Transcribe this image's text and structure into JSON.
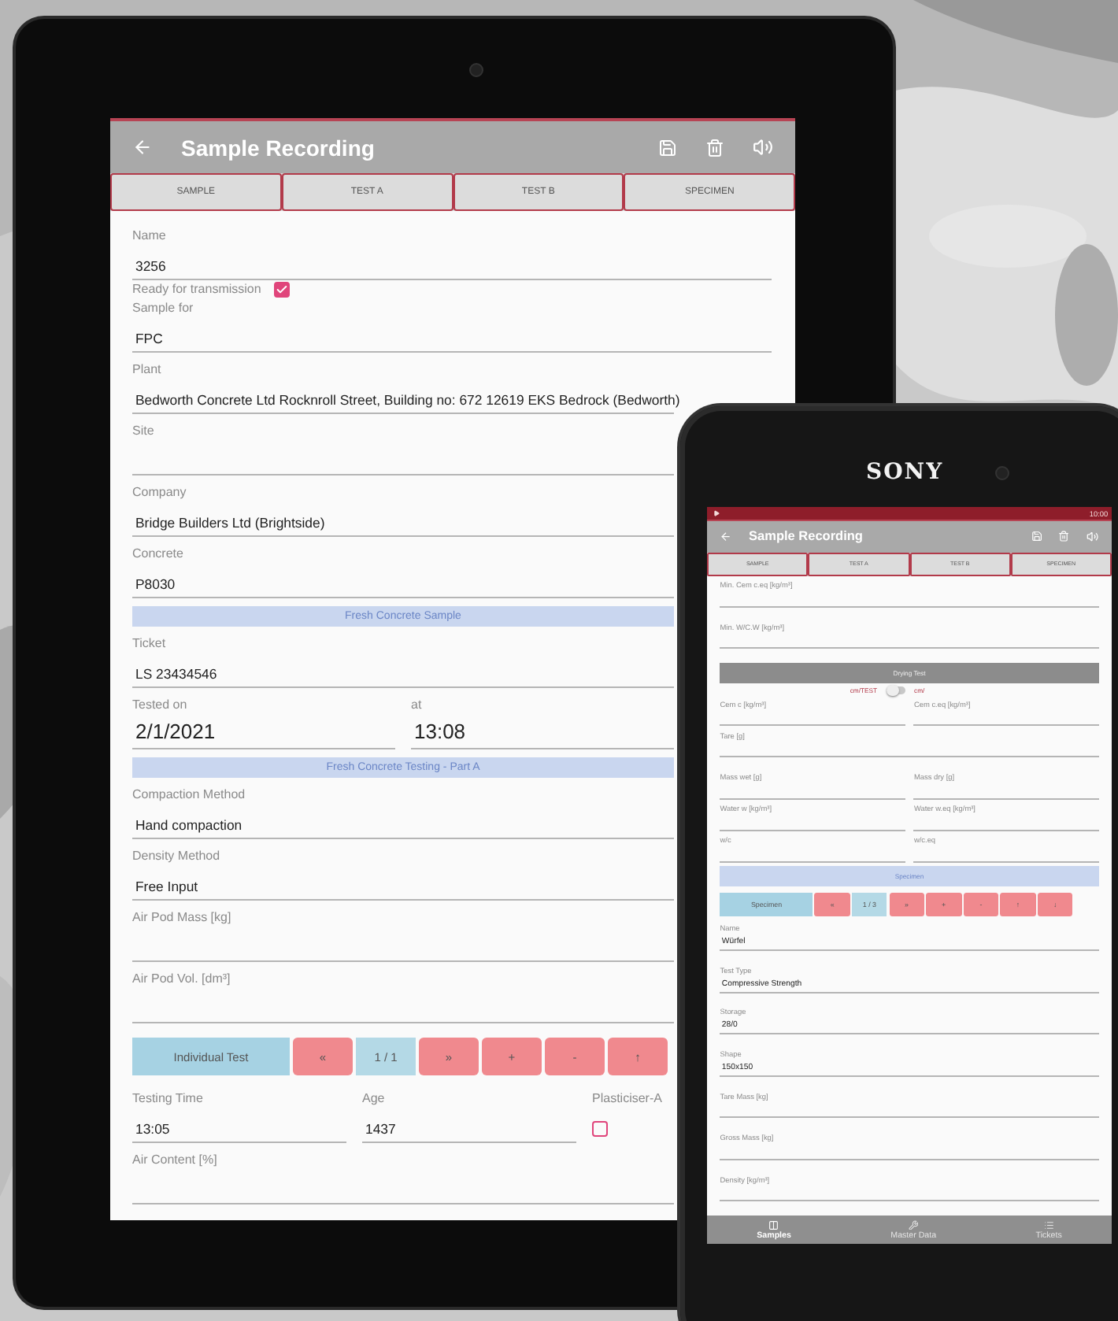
{
  "tablet": {
    "title": "Sample Recording",
    "tabs": [
      "SAMPLE",
      "TEST A",
      "TEST B",
      "SPECIMEN"
    ],
    "items": [
      {
        "kind": "field",
        "label": "Name",
        "value": "3256"
      },
      {
        "kind": "checkbox",
        "label": "Ready for transmission",
        "checked": true
      },
      {
        "kind": "field",
        "label": "Sample for",
        "value": "FPC"
      },
      {
        "kind": "field",
        "label": "Plant",
        "value": "Bedworth Concrete Ltd Rocknroll Street, Building no: 672 12619 EKS Bedrock (Bedworth)"
      },
      {
        "kind": "field",
        "label": "Site"
      },
      {
        "kind": "field",
        "label": "Company",
        "value": "Bridge Builders Ltd (Brightside)"
      },
      {
        "kind": "field",
        "label": "Concrete",
        "value": "P8030"
      },
      {
        "kind": "section",
        "label": "Fresh Concrete Sample"
      },
      {
        "kind": "field",
        "label": "Ticket",
        "value": "LS 23434546"
      },
      {
        "kind": "row",
        "large": true,
        "cells": [
          {
            "kind": "field",
            "label": "Tested on",
            "value": "2/1/2021"
          },
          {
            "kind": "field",
            "label": "at",
            "value": "13:08"
          }
        ]
      },
      {
        "kind": "section",
        "label": "Fresh Concrete Testing - Part A"
      },
      {
        "kind": "field",
        "label": "Compaction Method",
        "value": "Hand compaction"
      },
      {
        "kind": "field",
        "label": "Density Method",
        "value": "Free Input"
      },
      {
        "kind": "field",
        "label": "Air Pod Mass [kg]"
      },
      {
        "kind": "field",
        "label": "Air Pod Vol. [dm³]"
      },
      {
        "kind": "nav",
        "buttons": [
          {
            "kind": "label",
            "label": "Individual Test"
          },
          {
            "kind": "action",
            "label": "«"
          },
          {
            "kind": "counter",
            "label": "1 / 1"
          },
          {
            "kind": "action",
            "label": "»"
          },
          {
            "kind": "action",
            "label": "+"
          },
          {
            "kind": "action",
            "label": "-"
          },
          {
            "kind": "action",
            "label": "↑"
          }
        ]
      },
      {
        "kind": "row",
        "cells": [
          {
            "kind": "field",
            "label": "Testing Time",
            "value": "13:05"
          },
          {
            "kind": "field",
            "label": "Age",
            "value": "1437"
          },
          {
            "kind": "checkbox",
            "label": "Plasticiser-A",
            "checked": false
          }
        ]
      },
      {
        "kind": "field",
        "label": "Air Content [%]"
      }
    ]
  },
  "phone": {
    "brand": "SONY",
    "time": "10:00",
    "title": "Sample Recording",
    "tabs": [
      "SAMPLE",
      "TEST A",
      "TEST B",
      "SPECIMEN"
    ],
    "items": [
      {
        "kind": "field",
        "label": "Min. Cem c.eq [kg/m³]"
      },
      {
        "kind": "field",
        "label": "Min. W/C.W [kg/m³]"
      },
      {
        "kind": "header",
        "label": "Drying Test"
      },
      {
        "kind": "toggle",
        "left": "cm/TEST",
        "right": "cm/",
        "on": false
      },
      {
        "kind": "row",
        "cells": [
          {
            "kind": "field",
            "label": "Cem c [kg/m³]"
          },
          {
            "kind": "field",
            "label": "Cem c.eq [kg/m³]"
          }
        ]
      },
      {
        "kind": "field",
        "label": "Tare [g]"
      },
      {
        "kind": "row",
        "cells": [
          {
            "kind": "field",
            "label": "Mass wet [g]"
          },
          {
            "kind": "field",
            "label": "Mass dry [g]"
          }
        ]
      },
      {
        "kind": "row",
        "cells": [
          {
            "kind": "field",
            "label": "Water w [kg/m³]"
          },
          {
            "kind": "field",
            "label": "Water w.eq [kg/m³]"
          }
        ]
      },
      {
        "kind": "row",
        "cells": [
          {
            "kind": "field",
            "label": "w/c"
          },
          {
            "kind": "field",
            "label": "w/c.eq"
          }
        ]
      },
      {
        "kind": "section",
        "label": "Specimen"
      },
      {
        "kind": "nav",
        "buttons": [
          {
            "kind": "label",
            "label": "Specimen"
          },
          {
            "kind": "action",
            "label": "«"
          },
          {
            "kind": "counter",
            "label": "1 / 3"
          },
          {
            "kind": "action",
            "label": "»"
          },
          {
            "kind": "action",
            "label": "+"
          },
          {
            "kind": "action",
            "label": "-"
          },
          {
            "kind": "action",
            "label": "↑"
          },
          {
            "kind": "action",
            "label": "↓"
          }
        ]
      },
      {
        "kind": "field",
        "label": "Name",
        "value": "Würfel"
      },
      {
        "kind": "field",
        "label": "Test Type",
        "value": "Compressive Strength"
      },
      {
        "kind": "field",
        "label": "Storage",
        "value": "28/0"
      },
      {
        "kind": "field",
        "label": "Shape",
        "value": "150x150"
      },
      {
        "kind": "field",
        "label": "Tare Mass [kg]"
      },
      {
        "kind": "field",
        "label": "Gross Mass [kg]"
      },
      {
        "kind": "field",
        "label": "Density [kg/m³]"
      }
    ],
    "bottom_nav": [
      {
        "label": "Samples",
        "selected": true
      },
      {
        "label": "Master Data",
        "selected": false
      },
      {
        "label": "Tickets",
        "selected": false
      }
    ]
  }
}
